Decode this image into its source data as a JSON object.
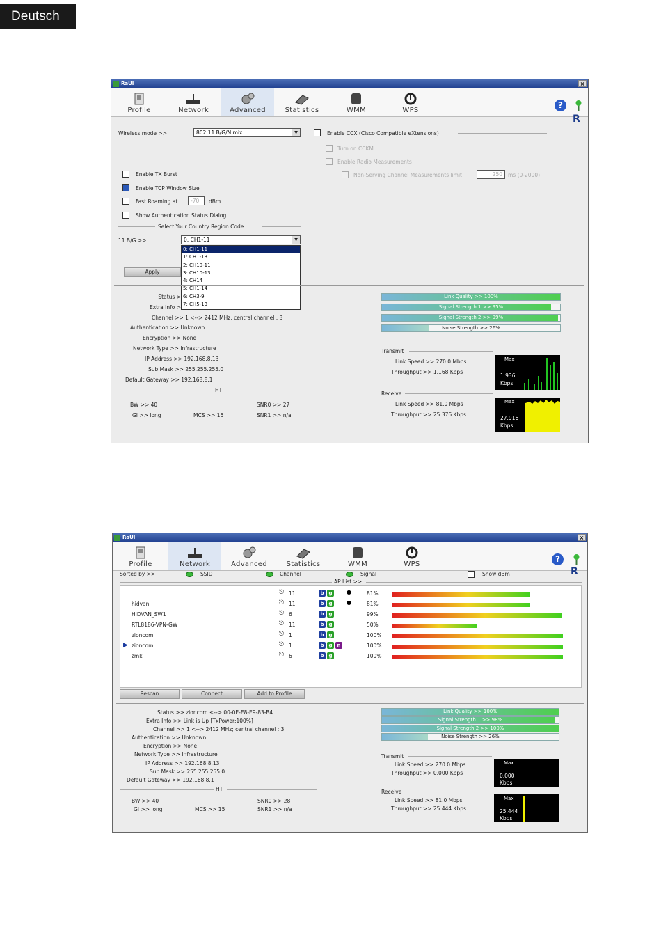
{
  "language_tab": "Deutsch",
  "colors": {
    "title_bar": "#1f3f8f",
    "selected_tab": "#dde6f3",
    "window_bg": "#ececec",
    "dropdown_highlight": "#0a246a",
    "graph_bg": "#000000",
    "receive_graph": "#f0f000",
    "transmit_graph": "#22c422"
  },
  "window1": {
    "title": "RaUI",
    "tabs": [
      {
        "label": "Profile",
        "icon": "profile-icon"
      },
      {
        "label": "Network",
        "icon": "network-icon"
      },
      {
        "label": "Advanced",
        "icon": "advanced-icon",
        "selected": true
      },
      {
        "label": "Statistics",
        "icon": "statistics-icon"
      },
      {
        "label": "WMM",
        "icon": "wmm-icon"
      },
      {
        "label": "WPS",
        "icon": "wps-icon"
      }
    ],
    "advanced": {
      "wireless_mode_label": "Wireless mode >>",
      "wireless_mode_value": "802.11 B/G/N mix",
      "ccx_label": "Enable CCX (Cisco Compatible eXtensions)",
      "ccx_checked": false,
      "turn_on_cckm": "Turn on CCKM",
      "radio_measurements": "Enable Radio Measurements",
      "non_serving_label": "Non-Serving Channel Measurements limit",
      "non_serving_value": "250",
      "non_serving_unit": "ms (0-2000)",
      "tx_burst": {
        "label": "Enable TX Burst",
        "checked": false
      },
      "tcp_window": {
        "label": "Enable TCP Window Size",
        "checked": true
      },
      "fast_roaming": {
        "label": "Fast Roaming at",
        "value": "-70",
        "unit": "dBm",
        "checked": false
      },
      "auth_status": {
        "label": "Show Authentication Status Dialog",
        "checked": false
      },
      "country_region_title": "Select Your Country Region Code",
      "band_label": "11 B/G >>",
      "band_value": "0: CH1-11",
      "dropdown_options": [
        "0: CH1-11",
        "1: CH1-13",
        "2: CH10-11",
        "3: CH10-13",
        "4: CH14",
        "5: CH1-14",
        "6: CH3-9",
        "7: CH5-13"
      ],
      "apply_label": "Apply"
    },
    "status": {
      "status_label": "Status >",
      "extra_info_label": "Extra Info >",
      "channel": "Channel >> 1 <--> 2412 MHz; central channel : 3",
      "authentication": "Authentication >> Unknown",
      "encryption": "Encryption >> None",
      "network_type": "Network Type >> Infrastructure",
      "ip_address": "IP Address >> 192.168.8.13",
      "sub_mask": "Sub Mask >> 255.255.255.0",
      "default_gateway": "Default Gateway >> 192.168.8.1",
      "ht_title": "HT",
      "bw": "BW >> 40",
      "gi": "GI >> long",
      "mcs": "MCS >> 15",
      "snr0": "SNR0 >> 27",
      "snr1": "SNR1 >> n/a"
    },
    "quality": [
      {
        "text": "Link Quality >> 100%",
        "level": 1.0
      },
      {
        "text": "Signal Strength 1 >> 95%",
        "level": 0.95
      },
      {
        "text": "Signal Strength 2 >> 99%",
        "level": 0.99
      },
      {
        "text": "Noise Strength >> 26%",
        "level": 0.26
      }
    ],
    "transmit": {
      "title": "Transmit",
      "link_speed": "Link Speed >> 270.0 Mbps",
      "throughput": "Throughput >> 1.168 Kbps",
      "graph_max": "Max",
      "graph_value_1": "1.936",
      "graph_value_2": "Kbps"
    },
    "receive": {
      "title": "Receive",
      "link_speed": "Link Speed >> 81.0 Mbps",
      "throughput": "Throughput >> 25.376 Kbps",
      "graph_max": "Max",
      "graph_value_1": "27.916",
      "graph_value_2": "Kbps"
    }
  },
  "window2": {
    "title": "RaUI",
    "tabs": [
      {
        "label": "Profile",
        "icon": "profile-icon"
      },
      {
        "label": "Network",
        "icon": "network-icon",
        "selected": true
      },
      {
        "label": "Advanced",
        "icon": "advanced-icon"
      },
      {
        "label": "Statistics",
        "icon": "statistics-icon"
      },
      {
        "label": "WMM",
        "icon": "wmm-icon"
      },
      {
        "label": "WPS",
        "icon": "wps-icon"
      }
    ],
    "sorted_by": "Sorted by >>",
    "sort_ssid": "SSID",
    "sort_channel": "Channel",
    "sort_signal": "Signal",
    "show_dbm": "Show dBm",
    "ap_list_title": "AP List >>",
    "ap_list": [
      {
        "ssid": "",
        "channel": "11",
        "modes": [
          "b",
          "g"
        ],
        "secure": true,
        "signal": "81%",
        "level": 0.81
      },
      {
        "ssid": "hidvan",
        "channel": "11",
        "modes": [
          "b",
          "g"
        ],
        "secure": true,
        "signal": "81%",
        "level": 0.81
      },
      {
        "ssid": "HIDVAN_SW1",
        "channel": "6",
        "modes": [
          "b",
          "g"
        ],
        "secure": false,
        "signal": "99%",
        "level": 0.99
      },
      {
        "ssid": "RTL8186-VPN-GW",
        "channel": "11",
        "modes": [
          "b",
          "g"
        ],
        "secure": false,
        "signal": "50%",
        "level": 0.5
      },
      {
        "ssid": "zioncom",
        "channel": "1",
        "modes": [
          "b",
          "g"
        ],
        "secure": false,
        "signal": "100%",
        "level": 1.0
      },
      {
        "ssid": "zioncom",
        "channel": "1",
        "modes": [
          "b",
          "g",
          "n"
        ],
        "secure": false,
        "signal": "100%",
        "level": 1.0,
        "connected": true
      },
      {
        "ssid": "zmk",
        "channel": "6",
        "modes": [
          "b",
          "g"
        ],
        "secure": false,
        "signal": "100%",
        "level": 1.0
      }
    ],
    "buttons": {
      "rescan": "Rescan",
      "connect": "Connect",
      "add_profile": "Add to Profile"
    },
    "status": {
      "status": "Status >> zioncom <--> 00-0E-E8-E9-83-B4",
      "extra_info": "Extra Info >> Link is Up [TxPower:100%]",
      "channel": "Channel >> 1 <--> 2412 MHz; central channel : 3",
      "authentication": "Authentication >> Unknown",
      "encryption": "Encryption >> None",
      "network_type": "Network Type >> Infrastructure",
      "ip_address": "IP Address >> 192.168.8.13",
      "sub_mask": "Sub Mask >> 255.255.255.0",
      "default_gateway": "Default Gateway >> 192.168.8.1",
      "ht_title": "HT",
      "bw": "BW >> 40",
      "gi": "GI >> long",
      "mcs": "MCS >> 15",
      "snr0": "SNR0 >> 28",
      "snr1": "SNR1 >> n/a"
    },
    "quality": [
      {
        "text": "Link Quality >> 100%",
        "level": 1.0
      },
      {
        "text": "Signal Strength 1 >> 98%",
        "level": 0.98
      },
      {
        "text": "Signal Strength 2 >> 100%",
        "level": 1.0
      },
      {
        "text": "Noise Strength >> 26%",
        "level": 0.26
      }
    ],
    "transmit": {
      "title": "Transmit",
      "link_speed": "Link Speed >> 270.0 Mbps",
      "throughput": "Throughput >> 0.000 Kbps",
      "graph_max": "Max",
      "graph_value_1": "0.000",
      "graph_value_2": "Kbps"
    },
    "receive": {
      "title": "Receive",
      "link_speed": "Link Speed >> 81.0 Mbps",
      "throughput": "Throughput >> 25.444 Kbps",
      "graph_max": "Max",
      "graph_value_1": "25.444",
      "graph_value_2": "Kbps"
    }
  }
}
